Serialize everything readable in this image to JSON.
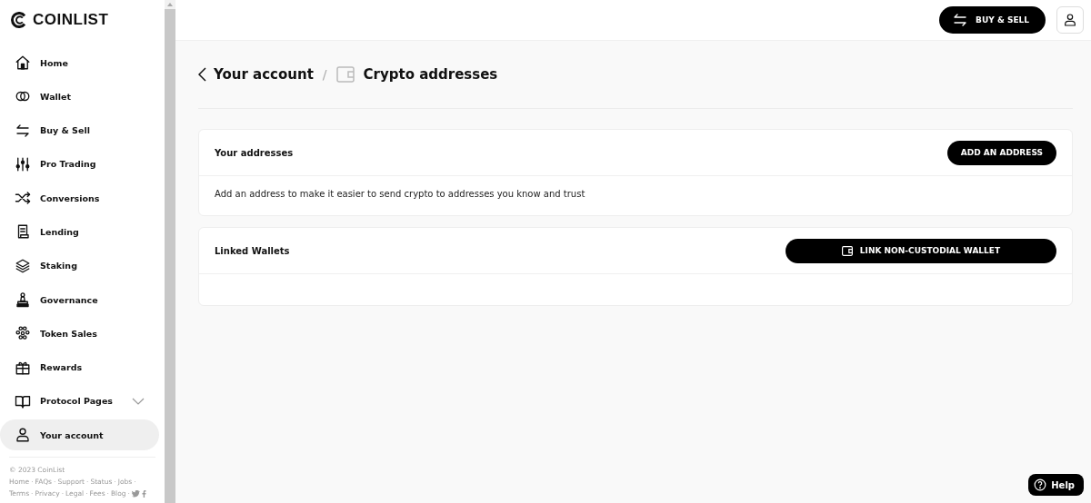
{
  "sidebar": {
    "logo": "COINLIST",
    "items": [
      {
        "label": "Home",
        "selected": false
      },
      {
        "label": "Wallet",
        "selected": false
      },
      {
        "label": "Buy & Sell",
        "selected": false
      },
      {
        "label": "Pro Trading",
        "selected": false
      },
      {
        "label": "Conversions",
        "selected": false
      },
      {
        "label": "Lending",
        "selected": false
      },
      {
        "label": "Staking",
        "selected": false
      },
      {
        "label": "Governance",
        "selected": false
      },
      {
        "label": "Token Sales",
        "selected": false
      },
      {
        "label": "Rewards",
        "selected": false
      },
      {
        "label": "Protocol Pages",
        "selected": false,
        "expanded": false
      },
      {
        "label": "Your account",
        "selected": true
      }
    ],
    "footer": {
      "copyright": "© 2023 CoinList",
      "separator": "·",
      "lines": [
        [
          "Home",
          "FAQs",
          "Support",
          "Status",
          "Jobs"
        ],
        [
          "Terms",
          "Privacy",
          "Legal",
          "Fees",
          "Blog"
        ]
      ]
    }
  },
  "topbar": {
    "buy_sell": "BUY & SELL"
  },
  "breadcrumb": {
    "parent": "Your account",
    "separator": "/",
    "current": "Crypto addresses"
  },
  "cards": [
    {
      "title": "Your addresses",
      "button": "ADD AN ADDRESS",
      "body": "Add an address to make it easier to send crypto to addresses you know and trust"
    },
    {
      "title": "Linked Wallets",
      "button": "LINK NON-CUSTODIAL WALLET"
    }
  ],
  "help": "Help"
}
